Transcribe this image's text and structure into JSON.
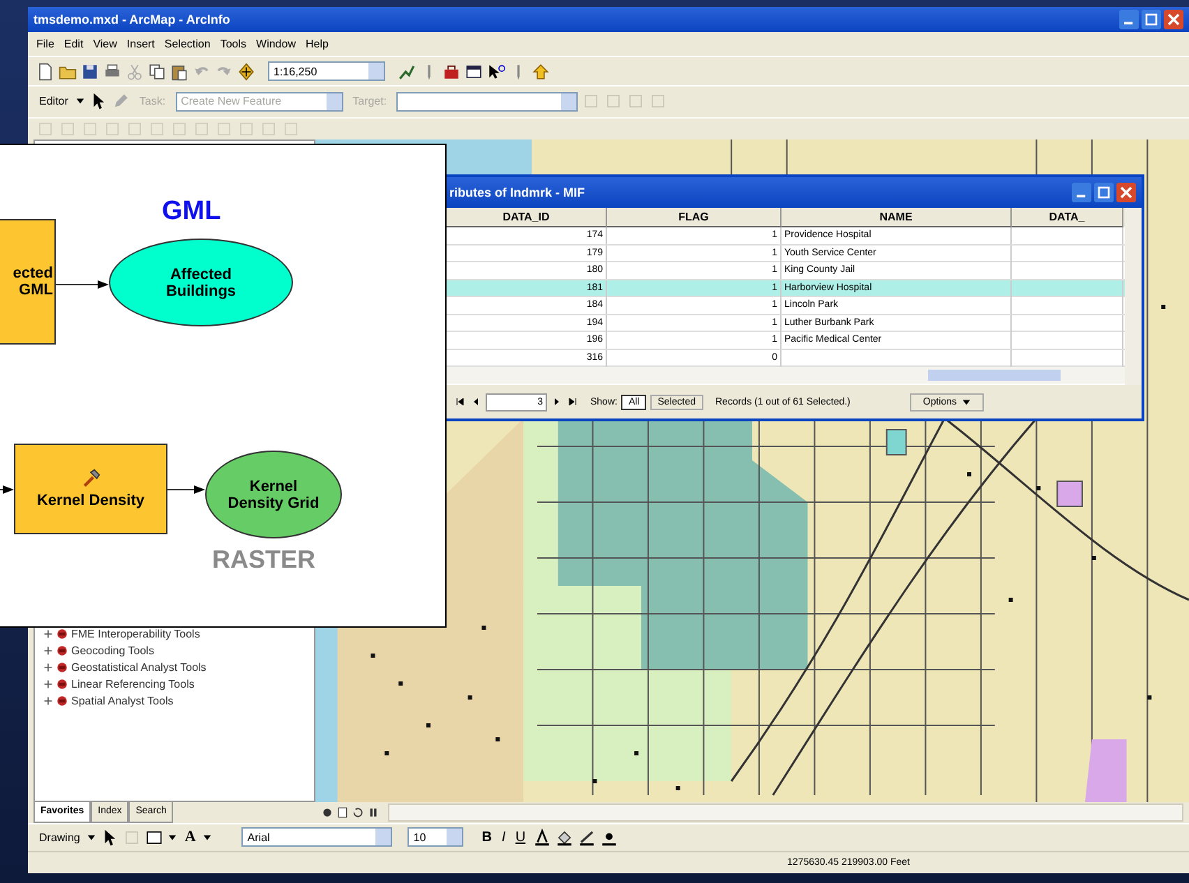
{
  "window": {
    "title": "tmsdemo.mxd - ArcMap - ArcInfo"
  },
  "menu": [
    "File",
    "Edit",
    "View",
    "Insert",
    "Selection",
    "Tools",
    "Window",
    "Help"
  ],
  "standard_toolbar": {
    "scale": "1:16,250"
  },
  "editor_toolbar": {
    "editor": "Editor",
    "task_label": "Task:",
    "task_value": "Create New Feature",
    "target_label": "Target:"
  },
  "toolbox": {
    "items": [
      {
        "label": "FME Interoperability Tools"
      },
      {
        "label": "Geocoding Tools"
      },
      {
        "label": "Geostatistical Analyst Tools"
      },
      {
        "label": "Linear Referencing Tools"
      },
      {
        "label": "Spatial Analyst Tools"
      }
    ],
    "tabs": [
      {
        "label": "Favorites",
        "selected": true
      },
      {
        "label": "Index",
        "selected": false
      },
      {
        "label": "Search",
        "selected": false
      }
    ]
  },
  "attribute_table": {
    "title": "ributes of Indmrk - MIF",
    "columns": [
      "DATA_ID",
      "FLAG",
      "NAME",
      "DATA_"
    ],
    "rows": [
      {
        "cells": [
          "174",
          "1",
          "Providence Hospital",
          ""
        ],
        "selected": false
      },
      {
        "cells": [
          "179",
          "1",
          "Youth Service Center",
          ""
        ],
        "selected": false
      },
      {
        "cells": [
          "180",
          "1",
          "King County Jail",
          ""
        ],
        "selected": false
      },
      {
        "cells": [
          "181",
          "1",
          "Harborview Hospital",
          ""
        ],
        "selected": true
      },
      {
        "cells": [
          "184",
          "1",
          "Lincoln Park",
          ""
        ],
        "selected": false
      },
      {
        "cells": [
          "194",
          "1",
          "Luther Burbank Park",
          ""
        ],
        "selected": false
      },
      {
        "cells": [
          "196",
          "1",
          "Pacific Medical Center",
          ""
        ],
        "selected": false
      },
      {
        "cells": [
          "316",
          "0",
          "",
          ""
        ],
        "selected": false
      }
    ],
    "record": "3",
    "show_label": "Show:",
    "show_options": [
      {
        "label": "All",
        "selected": true
      },
      {
        "label": "Selected",
        "selected": false
      }
    ],
    "records": "Records (1 out of 61 Selected.)",
    "options": "Options"
  },
  "diagram": {
    "gml_label": "GML",
    "raster_label": "RASTER",
    "nodes": [
      {
        "kind": "process",
        "text": "ected GML"
      },
      {
        "kind": "data",
        "text": "Affected Buildings",
        "color": "#00ffcc"
      },
      {
        "kind": "process",
        "text": "Kernel Density",
        "tool": true
      },
      {
        "kind": "data",
        "text": "Kernel Density Grid",
        "color": "#66cc66"
      }
    ]
  },
  "drawing_toolbar": {
    "menu": "Drawing",
    "text_tool": "A",
    "font": "Arial",
    "size": "10",
    "bold": "B",
    "italic": "I",
    "underline": "U"
  },
  "status_bar": {
    "coordinates": "1275630.45  219903.00 Feet"
  }
}
